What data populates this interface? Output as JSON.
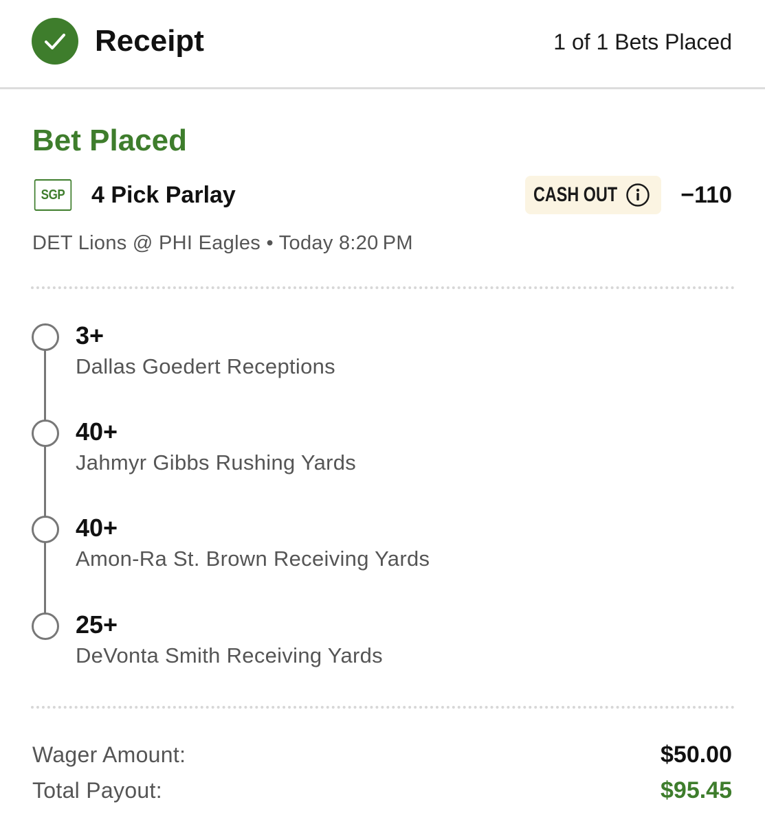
{
  "header": {
    "icon": "checkmark-circle-icon",
    "title": "Receipt",
    "bet_count": "1 of 1 Bets Placed"
  },
  "bet": {
    "status": "Bet Placed",
    "type_badge": "SGP",
    "title": "4 Pick Parlay",
    "cash_out_label": "CASH OUT",
    "odds": "−110",
    "game": "DET Lions @ PHI Eagles • Today 8:20 PM",
    "legs": [
      {
        "value": "3+",
        "description": "Dallas Goedert Receptions"
      },
      {
        "value": "40+",
        "description": "Jahmyr Gibbs Rushing Yards"
      },
      {
        "value": "40+",
        "description": "Amon-Ra St. Brown Receiving Yards"
      },
      {
        "value": "25+",
        "description": "DeVonta Smith Receiving Yards"
      }
    ]
  },
  "summary": {
    "wager_label": "Wager Amount:",
    "wager_value": "$50.00",
    "payout_label": "Total Payout:",
    "payout_value": "$95.45"
  },
  "colors": {
    "accent_green": "#3e7d2c",
    "cash_out_bg": "#fbf4e2",
    "muted_text": "#555555"
  }
}
